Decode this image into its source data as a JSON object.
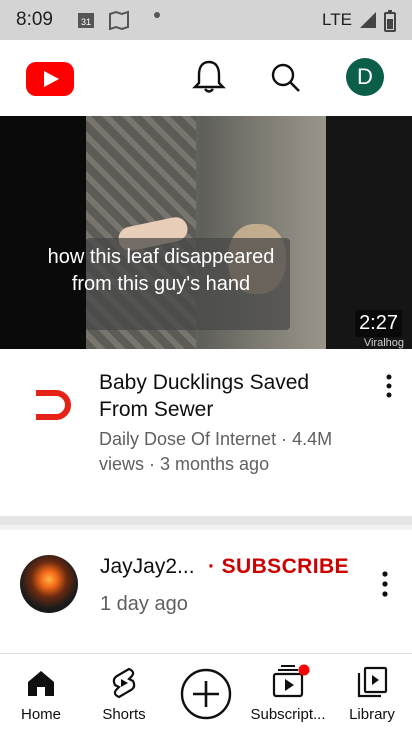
{
  "status": {
    "time": "8:09",
    "network": "LTE"
  },
  "app": {
    "avatar_letter": "D",
    "brand_color": "#ff0000"
  },
  "video": {
    "caption": "how this leaf disappeared from this guy's hand",
    "duration": "2:27",
    "watermark": "Viralhog"
  },
  "feed_item": {
    "title": "Baby Ducklings Saved From Sewer",
    "subtitle": "Daily Dose Of Internet · 4.4M views · 3 months ago"
  },
  "channel_item": {
    "name": "JayJay2...",
    "subscribe_label": "· SUBSCRIBE",
    "age": "1 day ago",
    "subscribe_color": "#cc0000"
  },
  "nav": {
    "home": "Home",
    "shorts": "Shorts",
    "subscriptions": "Subscript...",
    "library": "Library"
  }
}
